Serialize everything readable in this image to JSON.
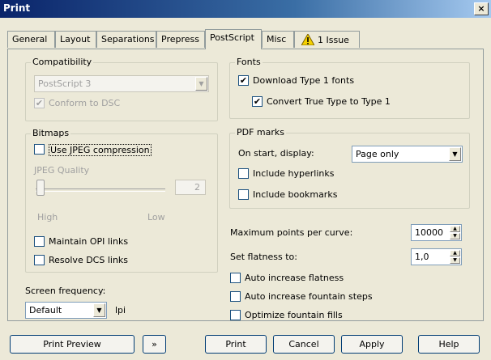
{
  "window": {
    "title": "Print",
    "close_symbol": "×"
  },
  "tabs": [
    {
      "label": "General"
    },
    {
      "label": "Layout"
    },
    {
      "label": "Separations"
    },
    {
      "label": "Prepress"
    },
    {
      "label": "PostScript",
      "active": true
    },
    {
      "label": "Misc"
    },
    {
      "label": "1 Issue",
      "icon": "warning-icon"
    }
  ],
  "compatibility": {
    "label": "Compatibility",
    "selected": "PostScript 3",
    "conform_dsc": {
      "label": "Conform to DSC",
      "checked": true,
      "disabled": true
    }
  },
  "bitmaps": {
    "label": "Bitmaps",
    "use_jpeg": {
      "label": "Use JPEG compression",
      "checked": false
    },
    "jpeg_quality_label": "JPEG Quality",
    "jpeg_quality_value": "2",
    "slider_level": 0.02,
    "high": "High",
    "low": "Low",
    "maintain_opi": {
      "label": "Maintain OPI links",
      "checked": false
    },
    "resolve_dcs": {
      "label": "Resolve DCS links",
      "checked": false
    }
  },
  "screen_frequency": {
    "label": "Screen frequency:",
    "selected": "Default",
    "unit": "lpi"
  },
  "fonts": {
    "label": "Fonts",
    "download_type1": {
      "label": "Download Type 1 fonts",
      "checked": true
    },
    "convert_tt": {
      "label": "Convert True Type to Type 1",
      "checked": true
    }
  },
  "pdf_marks": {
    "label": "PDF marks",
    "on_start_label": "On start, display:",
    "on_start_value": "Page only",
    "include_hyperlinks": {
      "label": "Include hyperlinks",
      "checked": false
    },
    "include_bookmarks": {
      "label": "Include bookmarks",
      "checked": false
    }
  },
  "curves": {
    "max_points_label": "Maximum points per curve:",
    "max_points_value": "10000",
    "flatness_label": "Set flatness to:",
    "flatness_value": "1,0",
    "auto_flatness": {
      "label": "Auto increase flatness",
      "checked": false
    },
    "auto_fountain": {
      "label": "Auto increase fountain steps",
      "checked": false
    },
    "optimize_fountain": {
      "label": "Optimize fountain fills",
      "checked": false
    }
  },
  "buttons": {
    "print_preview": "Print Preview",
    "preview_toggle_symbol": "»",
    "print": "Print",
    "cancel": "Cancel",
    "apply": "Apply",
    "help": "Help"
  },
  "check_symbol": "✔",
  "arrow_down": "▼",
  "arrow_up": "▲"
}
